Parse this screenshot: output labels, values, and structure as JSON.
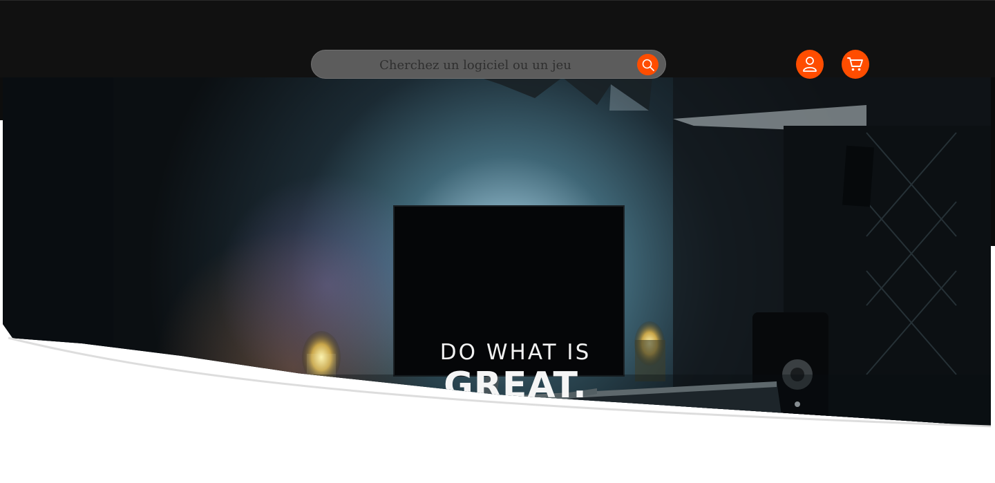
{
  "header": {
    "search": {
      "placeholder": "Cherchez un logiciel ou un jeu",
      "button_icon": "search-icon"
    },
    "account_icon": "user-icon",
    "cart_icon": "cart-icon"
  },
  "hero": {
    "screen_line1": "DO WHAT IS",
    "screen_line2": "GREAT."
  },
  "colors": {
    "accent": "#ff4d00",
    "header_bg": "#111111",
    "search_bg": "#5c5c5c"
  }
}
